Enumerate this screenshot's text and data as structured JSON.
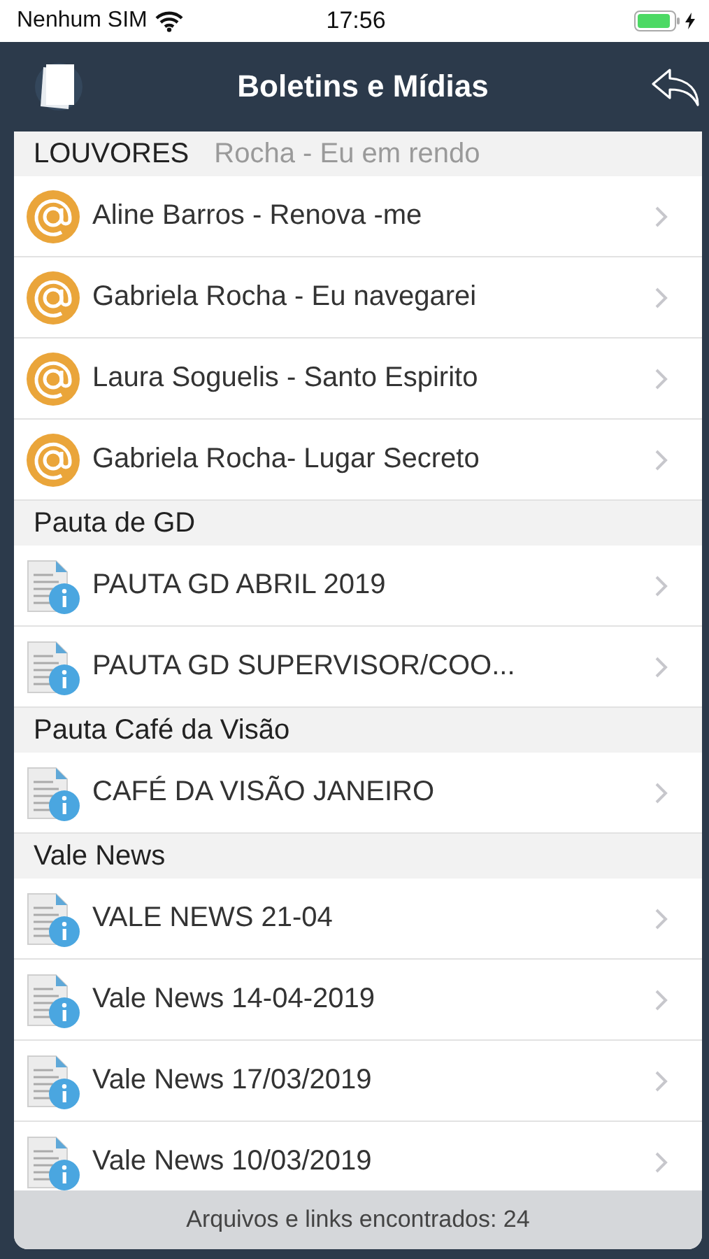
{
  "status_bar": {
    "carrier": "Nenhum SIM",
    "time": "17:56",
    "charging": true
  },
  "nav": {
    "title": "Boletins e Mídias"
  },
  "list": {
    "behind_first_header": {
      "label": "Rocha - Eu em rendo"
    },
    "sections": [
      {
        "title": "LOUVORES",
        "items": [
          {
            "kind": "at",
            "label": "Aline Barros - Renova -me"
          },
          {
            "kind": "at",
            "label": "Gabriela Rocha - Eu navegarei"
          },
          {
            "kind": "at",
            "label": "Laura Soguelis - Santo Espirito"
          },
          {
            "kind": "at",
            "label": "Gabriela Rocha- Lugar Secreto"
          }
        ]
      },
      {
        "title": "Pauta de GD",
        "items": [
          {
            "kind": "doc",
            "label": "PAUTA GD ABRIL 2019"
          },
          {
            "kind": "doc",
            "label": "PAUTA GD SUPERVISOR/COO..."
          }
        ]
      },
      {
        "title": "Pauta Café da Visão",
        "items": [
          {
            "kind": "doc",
            "label": "CAFÉ DA VISÃO JANEIRO"
          }
        ]
      },
      {
        "title": "Vale News",
        "items": [
          {
            "kind": "doc",
            "label": "VALE NEWS 21-04"
          },
          {
            "kind": "doc",
            "label": "Vale News 14-04-2019"
          },
          {
            "kind": "doc",
            "label": "Vale News 17/03/2019"
          },
          {
            "kind": "doc",
            "label": "Vale News 10/03/2019"
          }
        ]
      }
    ]
  },
  "footer": {
    "text": "Arquivos e links encontrados: 24"
  }
}
